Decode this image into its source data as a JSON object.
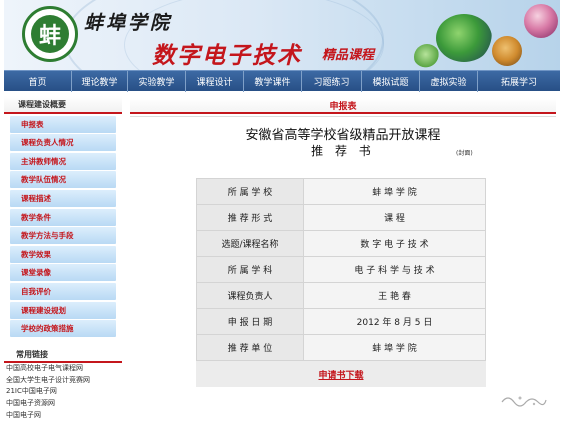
{
  "banner": {
    "school_name": "蚌埠学院",
    "site_title": "数字电子技术",
    "site_subtitle": "精品课程",
    "logo_char": "蚌"
  },
  "nav": {
    "items": [
      "首页",
      "理论教学",
      "实验教学",
      "课程设计",
      "教学课件",
      "习题练习",
      "模拟试题",
      "虚拟实验",
      "拓展学习"
    ]
  },
  "sidebar": {
    "title": "课程建设概要",
    "items": [
      "申报表",
      "课程负责人情况",
      "主讲教师情况",
      "教学队伍情况",
      "课程描述",
      "教学条件",
      "教学方法与手段",
      "教学效果",
      "课堂录像",
      "自我评价",
      "课程建设规划",
      "学校的政策措施"
    ],
    "links_title": "常用链接",
    "links": [
      "中国高校电子电气课程网",
      "全国大学生电子设计竞赛网",
      "21IC中国电子网",
      "中国电子资源网",
      "中国电子网"
    ]
  },
  "main": {
    "header": "申报表",
    "doc_title": "安徽省高等学校省级精品开放课程",
    "doc_subtitle": "推 荐 书",
    "cover_note": "(封面)",
    "rows": [
      {
        "label": "所 属 学 校",
        "value": "蚌 埠 学 院"
      },
      {
        "label": "推 荐 形 式",
        "value": "课    程"
      },
      {
        "label": "选题/课程名称",
        "value": "数 字 电 子 技 术"
      },
      {
        "label": "所 属 学 科",
        "value": "电 子 科 学 与 技 术"
      },
      {
        "label": "课程负责人",
        "value": "王 艳 春"
      },
      {
        "label": "申 报 日 期",
        "value": "2012 年  8 月  5 日"
      },
      {
        "label": "推 荐 单 位",
        "value": "蚌 埠 学 院"
      }
    ],
    "download_label": "申请书下载"
  },
  "colors": {
    "accent_red": "#c4161c",
    "nav_blue": "#2f5a93",
    "side_item_blue": "#c6e2f8"
  }
}
